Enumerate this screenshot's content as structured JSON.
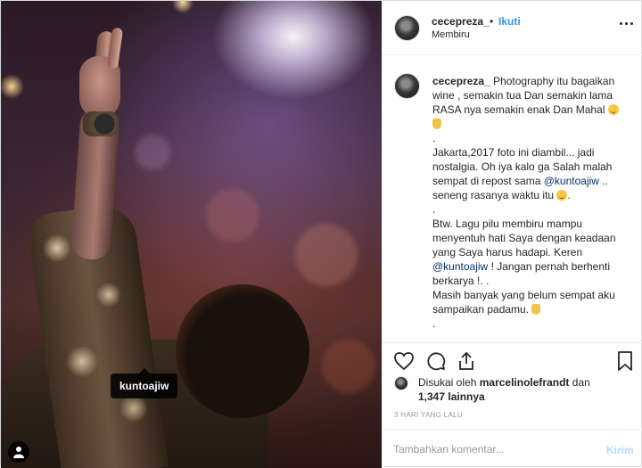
{
  "post": {
    "photo": {
      "tag_username": "kuntoajiw"
    },
    "header": {
      "username": "cecepreza_",
      "separator": "•",
      "follow_label": "Ikuti",
      "location": "Membiru"
    },
    "caption": {
      "username": "cecepreza_",
      "lines": [
        "Photography itu bagaikan wine , semakin tua Dan semakin lama RASA nya semakin enak Dan Mahal",
        ".",
        "Jakarta,2017 foto ini diambil... jadi nostalgia. Oh iya kalo ga Salah malah sempat di repost sama",
        "@kuntoajiw",
        "..",
        "seneng rasanya waktu itu",
        ".",
        "Btw. Lagu pilu membiru mampu menyentuh hati Saya dengan keadaan yang Saya harus hadapi. Keren",
        "@kuntoajiw",
        "! Jangan pernah berhenti berkarya !. .",
        "Masih banyak yang belum sempat aku sampaikan padamu.",
        "."
      ]
    },
    "actions": {
      "like_icon": "heart-icon",
      "comment_icon": "comment-icon",
      "share_icon": "share-icon",
      "save_icon": "bookmark-icon"
    },
    "likes": {
      "prefix": "Disukai oleh",
      "liker": "marcelinolefrandt",
      "joiner": "dan",
      "others": "1,347 lainnya"
    },
    "timestamp": "3 HARI YANG LALU",
    "comment": {
      "placeholder": "Tambahkan komentar...",
      "post_label": "Kirim"
    },
    "colors": {
      "link": "#3897f0",
      "mention": "#003569",
      "post_disabled": "#b3dbff",
      "muted": "#999999"
    }
  }
}
